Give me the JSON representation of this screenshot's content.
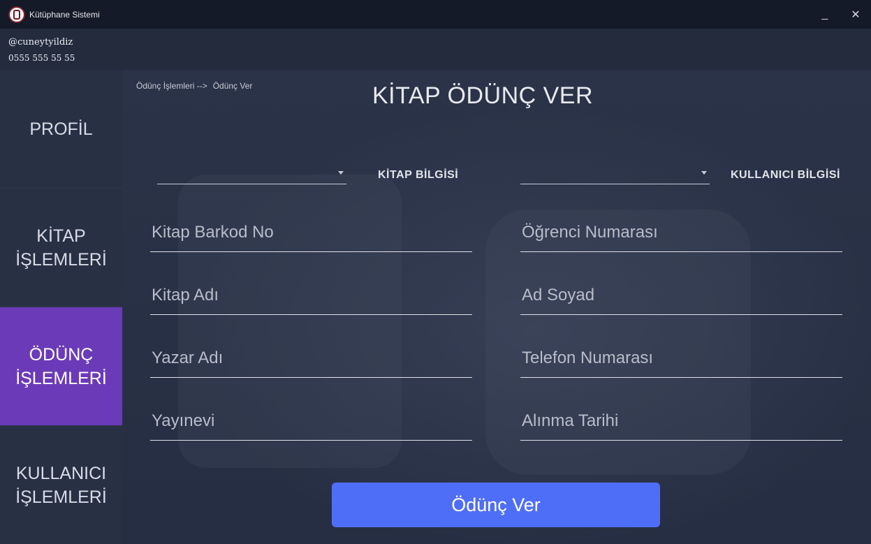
{
  "window": {
    "title": "Kütüphane Sistemi",
    "minimize": "_",
    "close": "✕"
  },
  "user": {
    "handle": "@cuneytyildiz",
    "phone": "0555 555 55 55"
  },
  "sidebar": {
    "items": [
      {
        "label_line1": "PROFİL",
        "label_line2": "",
        "active": false
      },
      {
        "label_line1": "KİTAP",
        "label_line2": "İŞLEMLERİ",
        "active": false
      },
      {
        "label_line1": "ÖDÜNÇ",
        "label_line2": "İŞLEMLERİ",
        "active": true
      },
      {
        "label_line1": "KULLANICI",
        "label_line2": "İŞLEMLERİ",
        "active": false
      }
    ]
  },
  "breadcrumb": {
    "part1": "Ödünç İşlemleri -->",
    "part2": "Ödünç Ver"
  },
  "page": {
    "title": "KİTAP ÖDÜNÇ VER"
  },
  "book_combo": {
    "label": "KİTAP BİLGİSİ",
    "value": ""
  },
  "user_combo": {
    "label": "KULLANICI BİLGİSİ",
    "value": ""
  },
  "book_fields": [
    {
      "placeholder": "Kitap Barkod No"
    },
    {
      "placeholder": "Kitap Adı"
    },
    {
      "placeholder": "Yazar Adı"
    },
    {
      "placeholder": "Yayınevi"
    }
  ],
  "user_fields": [
    {
      "placeholder": "Öğrenci Numarası"
    },
    {
      "placeholder": "Ad Soyad"
    },
    {
      "placeholder": "Telefon Numarası"
    },
    {
      "placeholder": "Alınma Tarihi"
    }
  ],
  "submit": {
    "label": "Ödünç Ver"
  },
  "colors": {
    "accent_active": "#6b3ab8",
    "button": "#4f6ef7",
    "titlebar": "#141a27"
  }
}
